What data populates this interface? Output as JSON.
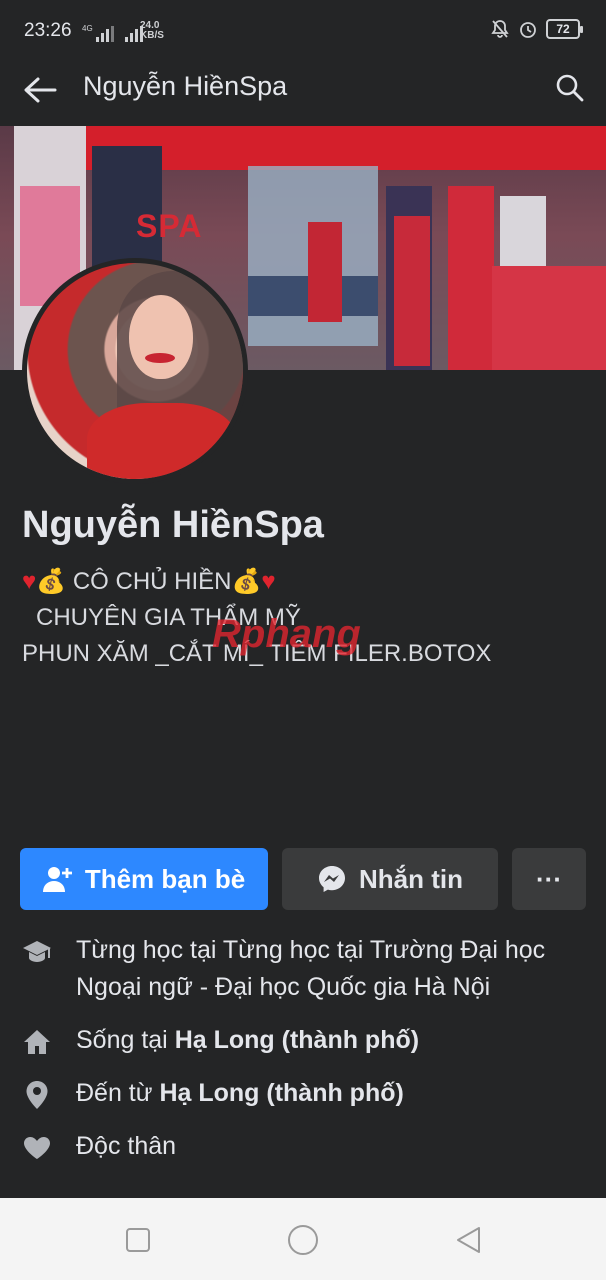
{
  "status_bar": {
    "time": "23:26",
    "network_type": "4G",
    "speed_value": "24.0",
    "speed_unit": "KB/S",
    "battery_level": "72",
    "icons": [
      "signal-icon",
      "wifi-bars-icon",
      "mute-icon",
      "alarm-icon",
      "battery-icon"
    ]
  },
  "app_bar": {
    "title": "Nguyễn HiềnSpa",
    "back_icon": "arrow-left-icon",
    "search_icon": "search-icon"
  },
  "cover": {
    "sign_spa": "SPA"
  },
  "profile": {
    "name": "Nguyễn HiềnSpa",
    "bio_line1": "CÔ CHỦ HIỀN",
    "bio_line2": "CHUYÊN GIA THẨM MỸ",
    "bio_line3": "PHUN XĂM _CẮT MÍ_ TIÊM FILER.BOTOX",
    "watermark": "Rphang"
  },
  "actions": {
    "add_friend": "Thêm bạn bè",
    "message": "Nhắn tin",
    "more": "···"
  },
  "intro": {
    "education_prefix": "Từng học tại Từng học tại Trường Đại học Ngoại ngữ - Đại học Quốc gia Hà Nội",
    "lives_prefix": "Sống tại ",
    "lives_place": "Hạ Long (thành phố)",
    "from_prefix": "Đến từ ",
    "from_place": "Hạ Long (thành phố)",
    "relationship": "Độc thân"
  },
  "colors": {
    "background": "#242526",
    "primary_button": "#2d88ff",
    "secondary_button": "#3a3b3c",
    "text": "#e4e6eb"
  }
}
